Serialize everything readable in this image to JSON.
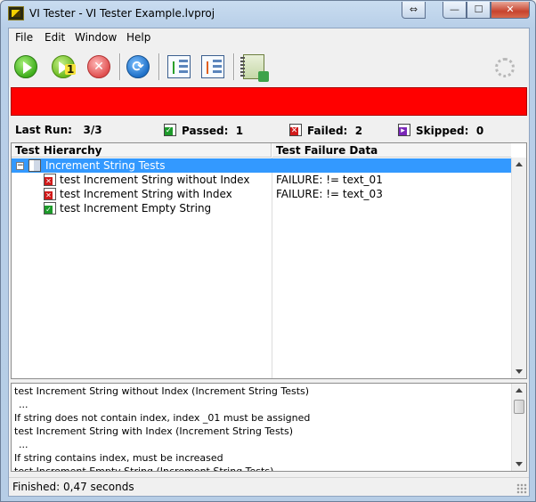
{
  "window": {
    "title": "VI Tester - VI Tester Example.lvproj",
    "swap_icon": "swap-arrows-icon",
    "min_label": "—",
    "max_label": "☐",
    "close_label": "✕"
  },
  "menu": [
    "File",
    "Edit",
    "Window",
    "Help"
  ],
  "toolbar": {
    "run_icon": "run-all-icon",
    "run_single_icon": "run-single-icon",
    "run_single_badge": "1",
    "abort_icon": "abort-icon",
    "abort_glyph": "✕",
    "refresh_icon": "refresh-icon",
    "refresh_glyph": "⟳",
    "expand_icon": "expand-tree-icon",
    "collapse_icon": "collapse-tree-icon",
    "report_icon": "save-report-icon",
    "busy_icon": "busy-indicator-icon"
  },
  "status": {
    "color": "#ff0000"
  },
  "summary": {
    "last_run_label": "Last Run:",
    "last_run_value": "3/3",
    "passed_label": "Passed:",
    "passed_value": "1",
    "failed_label": "Failed:",
    "failed_value": "2",
    "skipped_label": "Skipped:",
    "skipped_value": "0"
  },
  "tree": {
    "col_hierarchy": "Test Hierarchy",
    "col_failure": "Test Failure Data",
    "rows": [
      {
        "name": "Increment String Tests",
        "failure": "",
        "status": "suite"
      },
      {
        "name": "test Increment String without Index",
        "failure": "FAILURE:  != text_01",
        "status": "fail"
      },
      {
        "name": "test Increment String with Index",
        "failure": "FAILURE:  != text_03",
        "status": "fail"
      },
      {
        "name": "test Increment Empty String",
        "failure": "",
        "status": "pass"
      }
    ]
  },
  "log": {
    "lines": [
      "test Increment String without Index (Increment String Tests)",
      "...",
      "If string does not contain index, index _01 must be assigned",
      "test Increment String with Index (Increment String Tests)",
      "...",
      "If string contains index, must be increased",
      "test Increment Empty String (Increment String Tests)"
    ]
  },
  "footer": {
    "text": "Finished: 0,47 seconds"
  }
}
